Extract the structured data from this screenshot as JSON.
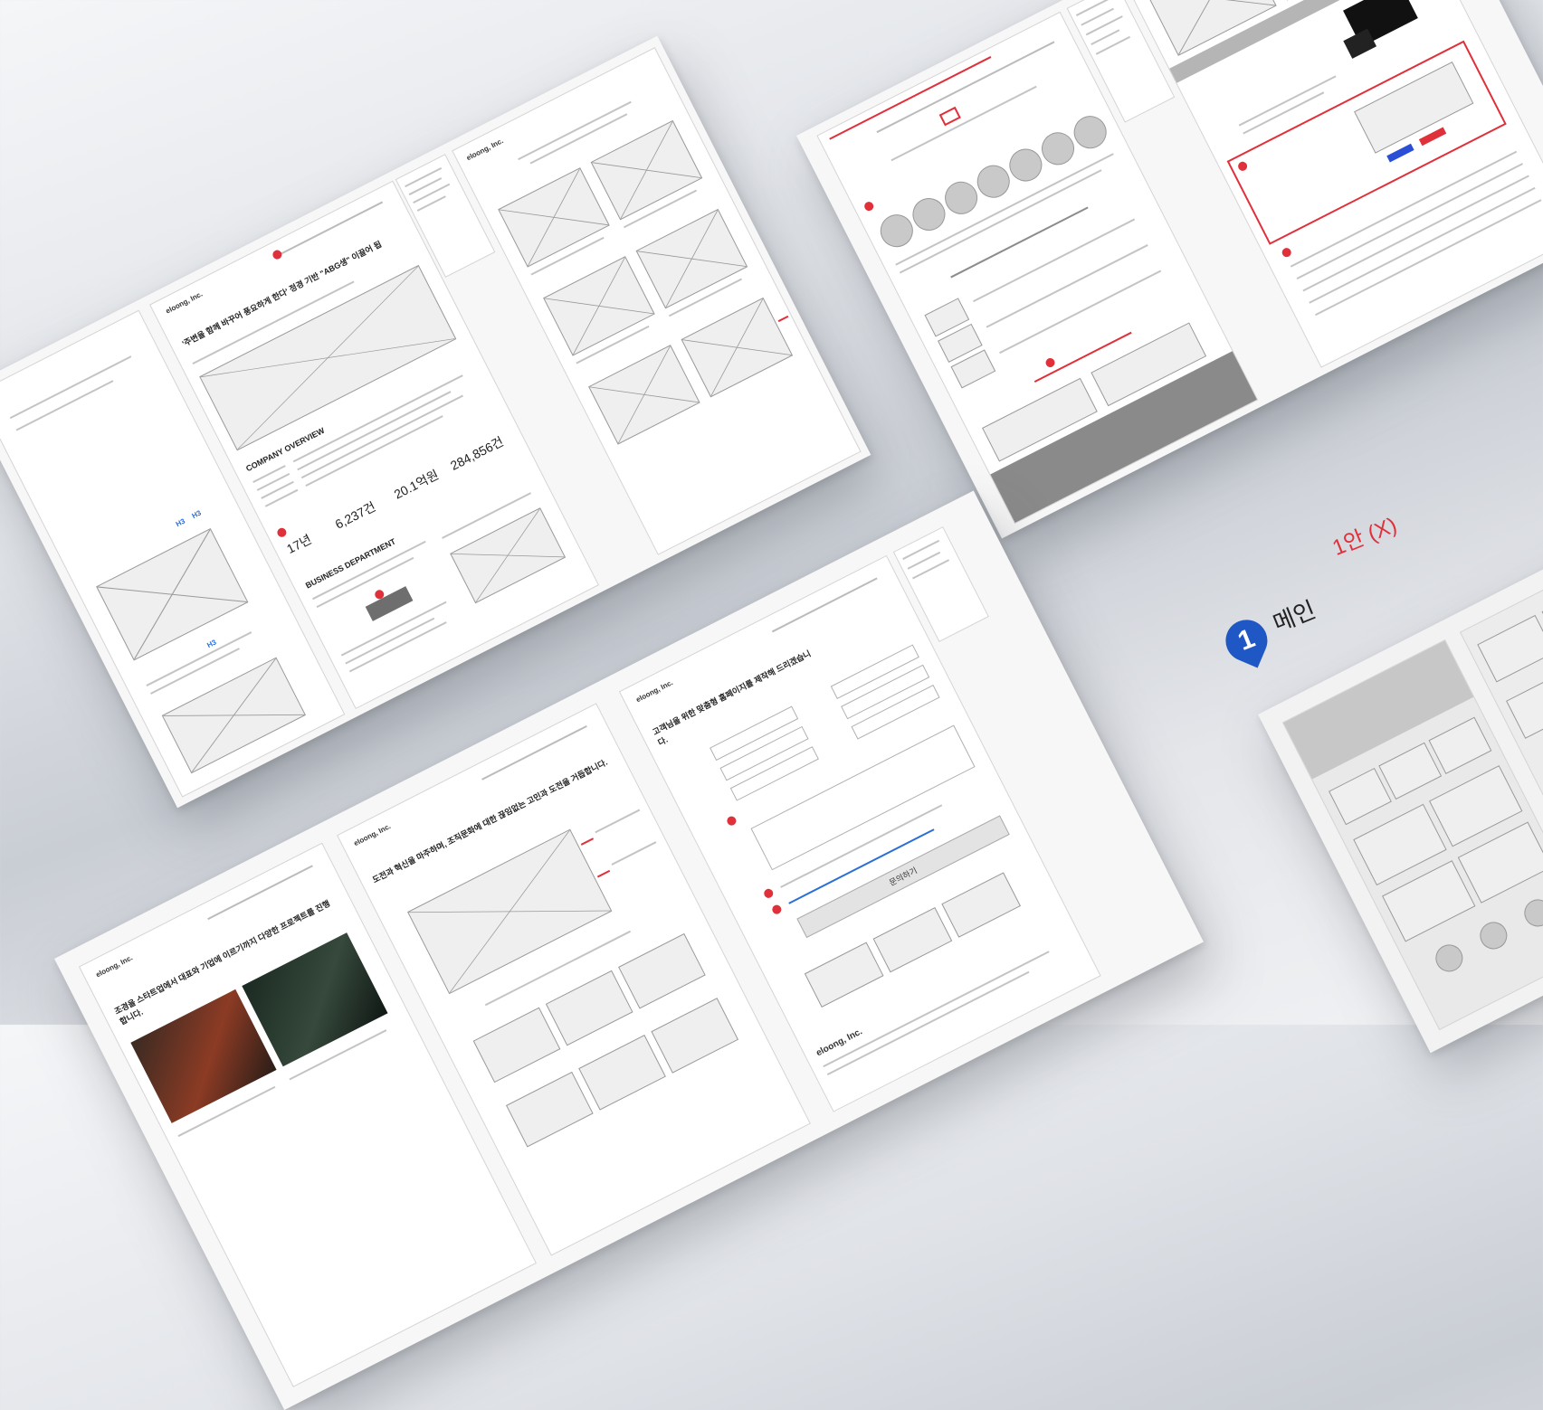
{
  "board1": {
    "logo": "eloong, Inc.",
    "headline": "'주변을 함께 바꾸어 풍요하게 한다' 정경 기반 \"ABG생\" 이끌어 됩",
    "company_overview": "COMPANY OVERVIEW",
    "stats": [
      "17년",
      "6,237건",
      "20.1억원",
      "284,856건"
    ],
    "business_department": "BUSINESS DEPARTMENT",
    "h3_marks": [
      "H3",
      "H3",
      "H3",
      "H3"
    ]
  },
  "board2": {
    "logo": "eloong, Inc.",
    "headline": "고객님을 위한 맞춤형 홈페이지를 제작해 드리겠습니다.",
    "submit_label": "문의하기"
  },
  "board3": {
    "logo": "eloong, Inc.",
    "headline": "도전과 혁신을 마주하며, 조직문화에 대한 끊임없는 고민과 도전을 거듭합니다.",
    "intro": "조경을 스타트업에서 대표와 기업에 이르기까지 다양한 프로젝트를 진행합니다."
  },
  "footer_logo": "eloong, Inc.",
  "label_group": {
    "marker_number": "1",
    "section_title": "메인",
    "variant_label": "1안 (X)"
  },
  "colors": {
    "accent_red": "#e0303a",
    "marker_blue": "#1f57c4",
    "link_blue": "#2a6fd6"
  }
}
